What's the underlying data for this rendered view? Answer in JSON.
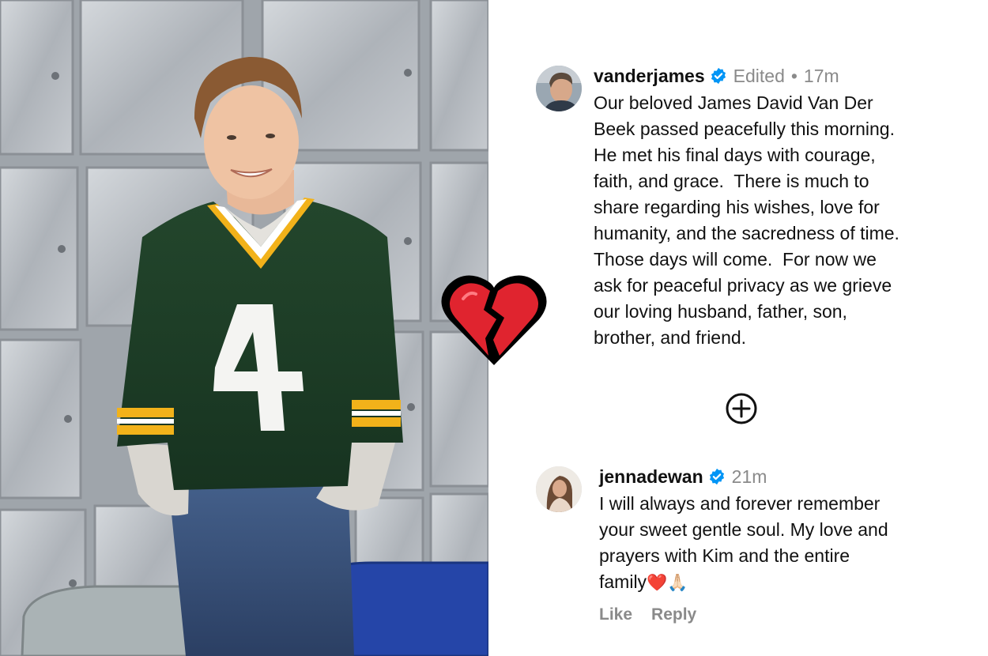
{
  "post_comment": {
    "username": "vanderjames",
    "edited_label": "Edited",
    "separator": "•",
    "time": "17m",
    "text_lines": [
      "Our beloved James David Van Der",
      "Beek passed peacefully this morning.",
      "He met his final days with courage,",
      "faith, and grace.  There is much to",
      "share regarding his wishes, love for",
      "humanity, and the sacredness of time.",
      "Those days will come.  For now we",
      "ask for peaceful privacy as we grieve",
      "our loving husband, father, son,",
      "brother, and friend."
    ]
  },
  "reply_comment": {
    "username": "jennadewan",
    "time": "21m",
    "text_lines": [
      "I will always and forever remember",
      "your sweet gentle soul. My love and",
      "prayers with Kim and the entire",
      "family"
    ],
    "trailing_emoji": "❤️🙏🏻",
    "like_label": "Like",
    "reply_label": "Reply"
  },
  "colors": {
    "verified_badge": "#0095f6",
    "meta_gray": "#8a8a8a",
    "heart_red": "#e0242f",
    "jersey_green": "#1f3f27",
    "jersey_gold": "#f2b21a"
  },
  "icons": [
    "verified-badge-icon",
    "broken-heart-icon",
    "plus-circle-icon"
  ]
}
